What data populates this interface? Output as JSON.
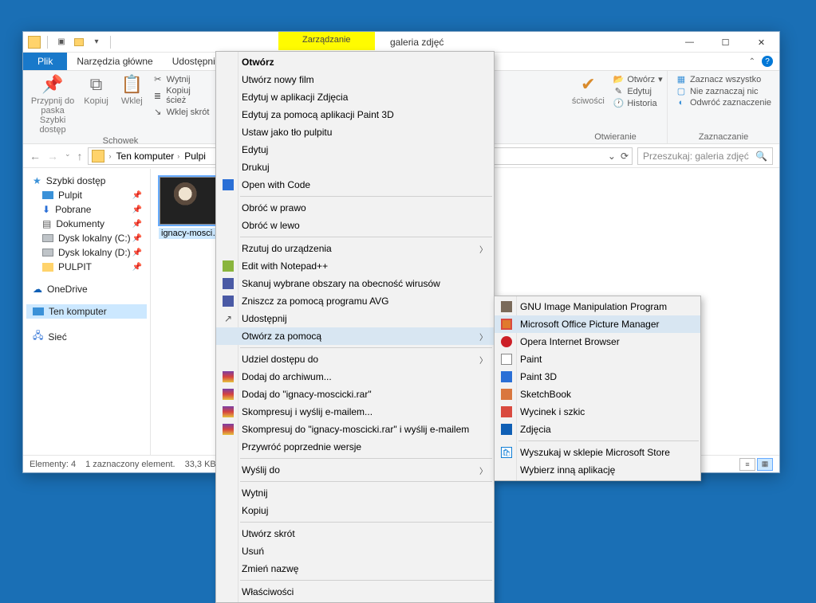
{
  "window": {
    "contextual_tab": "Zarządzanie",
    "title": "galeria zdjęć"
  },
  "ribbon_tabs": {
    "file": "Plik",
    "home": "Narzędzia główne",
    "share": "Udostępnianie"
  },
  "ribbon": {
    "clipboard": {
      "label": "Schowek",
      "pin": "Przypnij do paska\nSzybki dostęp",
      "copy": "Kopiuj",
      "paste": "Wklej",
      "cut": "Wytnij",
      "copy_path": "Kopiuj ścież",
      "paste_shortcut": "Wklej skrót"
    },
    "open": {
      "label": "Otwieranie",
      "props": "ściwości",
      "open": "Otwórz",
      "edit": "Edytuj",
      "history": "Historia"
    },
    "select": {
      "label": "Zaznaczanie",
      "all": "Zaznacz wszystko",
      "none": "Nie zaznaczaj nic",
      "invert": "Odwróć zaznaczenie"
    }
  },
  "address": {
    "segs": [
      "Ten komputer",
      "Pulpi"
    ],
    "search_placeholder": "Przeszukaj: galeria zdjęć"
  },
  "sidebar": {
    "quick": "Szybki dostęp",
    "items": [
      {
        "label": "Pulpit",
        "type": "monitor"
      },
      {
        "label": "Pobrane",
        "type": "folder-blue"
      },
      {
        "label": "Dokumenty",
        "type": "doc"
      },
      {
        "label": "Dysk lokalny (C:)",
        "type": "drive"
      },
      {
        "label": "Dysk lokalny (D:)",
        "type": "drive"
      },
      {
        "label": "PULPIT",
        "type": "folder"
      }
    ],
    "onedrive": "OneDrive",
    "thispc": "Ten komputer",
    "network": "Sieć"
  },
  "content": {
    "file_label": "ignacy-moscicki"
  },
  "status": {
    "count": "Elementy: 4",
    "selection": "1 zaznaczony element.",
    "size": "33,3 KB"
  },
  "context_menu": {
    "items": [
      {
        "label": "Otwórz",
        "bold": true
      },
      {
        "label": "Utwórz nowy film"
      },
      {
        "label": "Edytuj w aplikacji Zdjęcia"
      },
      {
        "label": "Edytuj za pomocą aplikacji Paint 3D"
      },
      {
        "label": "Ustaw jako tło pulpitu"
      },
      {
        "label": "Edytuj"
      },
      {
        "label": "Drukuj"
      },
      {
        "label": "Open with Code",
        "icon": "vscode"
      },
      {
        "sep": true
      },
      {
        "label": "Obróć w prawo"
      },
      {
        "label": "Obróć w lewo"
      },
      {
        "sep": true
      },
      {
        "label": "Rzutuj do urządzenia",
        "arrow": true
      },
      {
        "label": "Edit with Notepad++",
        "icon": "npp"
      },
      {
        "label": "Skanuj wybrane obszary na obecność wirusów",
        "icon": "avg"
      },
      {
        "label": "Zniszcz za pomocą programu AVG",
        "icon": "avg2"
      },
      {
        "label": "Udostępnij",
        "icon": "share"
      },
      {
        "label": "Otwórz za pomocą",
        "arrow": true,
        "highlight": true
      },
      {
        "sep": true
      },
      {
        "label": "Udziel dostępu do",
        "arrow": true
      },
      {
        "label": "Dodaj do archiwum...",
        "icon": "rar"
      },
      {
        "label": "Dodaj do \"ignacy-moscicki.rar\"",
        "icon": "rar"
      },
      {
        "label": "Skompresuj i wyślij e-mailem...",
        "icon": "rar"
      },
      {
        "label": "Skompresuj do \"ignacy-moscicki.rar\" i wyślij e-mailem",
        "icon": "rar"
      },
      {
        "label": "Przywróć poprzednie wersje"
      },
      {
        "sep": true
      },
      {
        "label": "Wyślij do",
        "arrow": true
      },
      {
        "sep": true
      },
      {
        "label": "Wytnij"
      },
      {
        "label": "Kopiuj"
      },
      {
        "sep": true
      },
      {
        "label": "Utwórz skrót"
      },
      {
        "label": "Usuń"
      },
      {
        "label": "Zmień nazwę"
      },
      {
        "sep": true
      },
      {
        "label": "Właściwości"
      }
    ]
  },
  "submenu": {
    "items": [
      {
        "label": "GNU Image Manipulation Program",
        "icon": "gimp"
      },
      {
        "label": "Microsoft Office Picture Manager",
        "icon": "mo",
        "highlight": true
      },
      {
        "label": "Opera Internet Browser",
        "icon": "opera"
      },
      {
        "label": "Paint",
        "icon": "paint"
      },
      {
        "label": "Paint 3D",
        "icon": "paint3d"
      },
      {
        "label": "SketchBook",
        "icon": "sketch"
      },
      {
        "label": "Wycinek i szkic",
        "icon": "snip"
      },
      {
        "label": "Zdjęcia",
        "icon": "photos"
      },
      {
        "sep": true
      },
      {
        "label": "Wyszukaj w sklepie Microsoft Store",
        "icon": "store"
      },
      {
        "label": "Wybierz inną aplikację"
      }
    ]
  }
}
